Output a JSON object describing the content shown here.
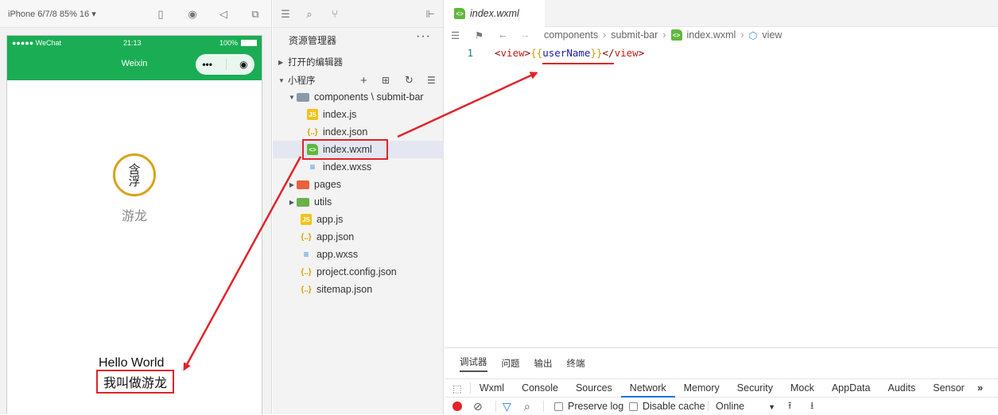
{
  "simulator": {
    "device_label": "iPhone 6/7/8 85% 16 ▾",
    "status": {
      "carrier": "●●●●● WeChat",
      "time": "21:13",
      "battery": "100%"
    },
    "nav_title": "Weixin",
    "capsule": {
      "more": "•••",
      "close": "◉"
    },
    "avatar_text": "含浮",
    "nickname": "游龙",
    "hello_text": "Hello World",
    "intro_text": "我叫做游龙"
  },
  "explorer": {
    "title": "资源管理器",
    "more": "···",
    "open_editors": "打开的编辑器",
    "project": "小程序",
    "tree": [
      {
        "label": "components \\ submit-bar",
        "kind": "folder-open"
      },
      {
        "label": "index.js",
        "kind": "js"
      },
      {
        "label": "index.json",
        "kind": "json"
      },
      {
        "label": "index.wxml",
        "kind": "wxml"
      },
      {
        "label": "index.wxss",
        "kind": "wxss"
      },
      {
        "label": "pages",
        "kind": "folder"
      },
      {
        "label": "utils",
        "kind": "folder"
      },
      {
        "label": "app.js",
        "kind": "js"
      },
      {
        "label": "app.json",
        "kind": "json"
      },
      {
        "label": "app.wxss",
        "kind": "wxss"
      },
      {
        "label": "project.config.json",
        "kind": "json"
      },
      {
        "label": "sitemap.json",
        "kind": "json"
      }
    ]
  },
  "editor": {
    "tab": "index.wxml",
    "breadcrumb": [
      "components",
      "submit-bar",
      "index.wxml",
      "view"
    ],
    "line_number": "1",
    "code": {
      "open_lt": "<",
      "open_name": "view",
      "open_gt": ">",
      "brace_open": "{",
      "brace_open2": "{",
      "var": "userName",
      "brace_close": "}",
      "brace_close2": "}",
      "close_lt": "</",
      "close_name": "view",
      "close_gt": ">"
    }
  },
  "devtools": {
    "top_tabs": [
      "调试器",
      "问题",
      "输出",
      "终端"
    ],
    "tabs": [
      "Wxml",
      "Console",
      "Sources",
      "Network",
      "Memory",
      "Security",
      "Mock",
      "AppData",
      "Audits",
      "Sensor"
    ],
    "active_tab": "Network",
    "more": "»",
    "preserve_log": "Preserve log",
    "disable_cache": "Disable cache",
    "throttle": "Online"
  },
  "colors": {
    "wechat_green": "#1aad54",
    "highlight_red": "#e0242a",
    "accent_blue": "#1a73e8"
  }
}
